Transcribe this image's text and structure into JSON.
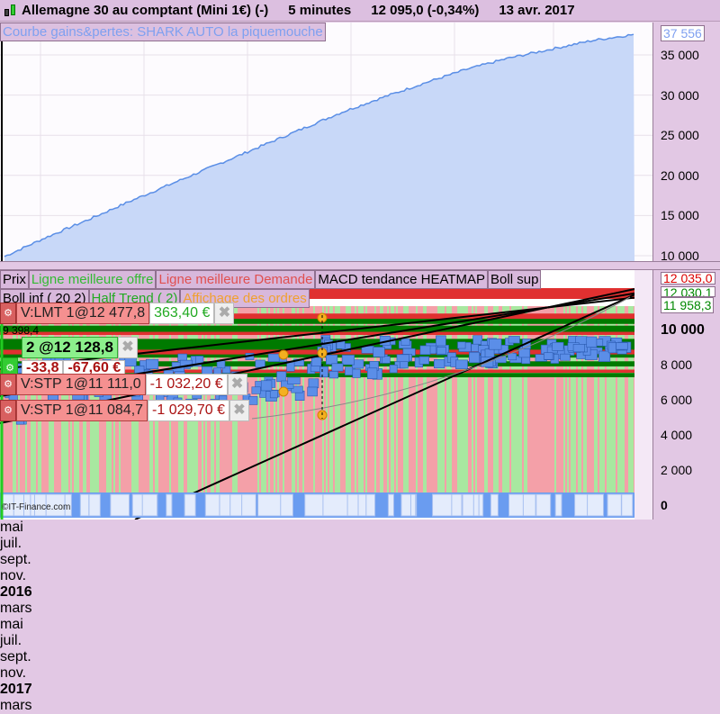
{
  "title": {
    "instrument": "Allemagne 30 au comptant (Mini 1€) (-)",
    "timeframe": "5 minutes",
    "price": "12 095,0 (-0,34%)",
    "date": "13 avr. 2017"
  },
  "top_panel": {
    "label": "Courbe gains&pertes: SHARK AUTO la piquemouche",
    "current_value": "37 556",
    "y_ticks": [
      "35 000",
      "30 000",
      "25 000",
      "20 000",
      "15 000",
      "10 000"
    ],
    "equity_points": [
      9900,
      12300,
      14500,
      16800,
      19000,
      21200,
      23400,
      25600,
      27800,
      29700,
      31500,
      33200,
      34600,
      35700,
      36800,
      37556
    ],
    "fill_color": "#c8d8f8",
    "line_color": "#5a8ee6"
  },
  "bottom_panel": {
    "legend_row1": [
      {
        "text": "Prix",
        "color": "#000000"
      },
      {
        "text": "Ligne meilleure offre",
        "color": "#33bb33"
      },
      {
        "text": "Ligne meilleure Demande",
        "color": "#e05050"
      },
      {
        "text": "MACD tendance HEATMAP",
        "color": "#000000"
      },
      {
        "text": "Boll sup",
        "color": "#000000"
      }
    ],
    "legend_row2": [
      {
        "text": "Boll inf ( 20 2)",
        "color": "#000000"
      },
      {
        "text": "Half Trend ( 2)",
        "color": "#22aa22"
      },
      {
        "text": "Affichage des ordres",
        "color": "#f0a030"
      }
    ],
    "price_labels": {
      "ask": "12 035,0",
      "bid": "12 030,1",
      "half_trend": "11 958,3"
    },
    "y_ticks": [
      "10 000",
      "8 000",
      "6 000",
      "4 000",
      "2 000",
      "0"
    ],
    "orders": [
      {
        "name": "V:LMT 1@12 477,8",
        "value": "363,40 €",
        "value_color": "#22aa22"
      },
      {
        "name": "V:STP 1@11 111,0",
        "value": "-1 032,20 €",
        "value_color": "#aa1111"
      },
      {
        "name": "V:STP 1@11 084,7",
        "value": "-1 029,70 €",
        "value_color": "#aa1111"
      }
    ],
    "position": {
      "label": "2 @12 128,8",
      "points": "-33,8",
      "pnl": "-67,60 €"
    },
    "small_text": "9 398,4",
    "watermark": "©IT-Finance.com"
  },
  "date_axis": [
    "mai",
    "juil.",
    "sept.",
    "nov.",
    "2016",
    "mars",
    "mai",
    "juil.",
    "sept.",
    "nov.",
    "2017",
    "mars"
  ]
}
